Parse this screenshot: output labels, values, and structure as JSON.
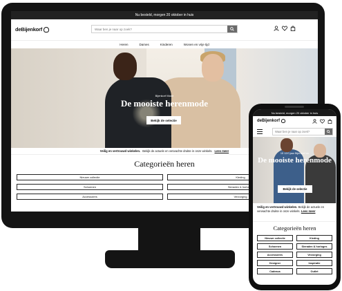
{
  "desktop": {
    "topbar": "Nu besteld, morgen 20 oktober in huis",
    "logo": "deBijenkorf",
    "search": {
      "placeholder": "Waar ben je naar op zoek?"
    },
    "icons": [
      "account-icon",
      "heart-icon",
      "bag-icon",
      "search-icon"
    ],
    "nav": [
      "Heren",
      "Dames",
      "Kinderen",
      "Wonen en vrije tijd"
    ],
    "hero": {
      "subtitle": "Bijenkorf Mode",
      "title": "De mooiste herenmode",
      "cta": "Bekijk de selectie"
    },
    "notice": {
      "bold": "Veilig en vertrouwd winkelen.",
      "text": "Bekijk de actuele en verwachte drukte in onze winkels.",
      "link": "Lees meer"
    },
    "categories": {
      "title": "Categorieën heren",
      "items": [
        "Nieuwe collectie",
        "Kleding",
        "Schoenen",
        "Sieraden & horloges",
        "Accessoires",
        "Verzorging"
      ]
    }
  },
  "mobile": {
    "statusbar": "Nu besteld, morgen 20 oktober in huis",
    "logo": "deBijenkorf",
    "search": {
      "placeholder": "Waar ben je naar op zoek?"
    },
    "hero": {
      "subtitle": "15 12/0 jaar Bijenkorf nu",
      "title": "De mooiste herenmode",
      "cta": "Bekijk de selectie"
    },
    "notice": {
      "bold": "Veilig en vertrouwd winkelen.",
      "text": "Bekijk de actuele en verwachte drukte in onze winkels.",
      "link": "Lees meer"
    },
    "categories": {
      "title": "Categorieën heren",
      "items": [
        "Nieuwe collectie",
        "Kleding",
        "Schoenen",
        "Sieraden & horloges",
        "Accessoires",
        "Verzorging",
        "Designer",
        "Inspiratie",
        "Cadeaus",
        "Outlet"
      ]
    }
  },
  "colors": {
    "frame": "#141414",
    "accent_dark": "#222222",
    "search_button": "#6b6b6b"
  }
}
